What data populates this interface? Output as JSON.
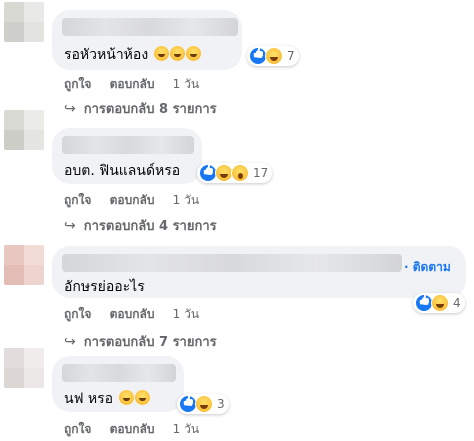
{
  "comments": [
    {
      "text": "รอหัวหน้าห้อง",
      "emojis": [
        "grinning-sweat-emoji",
        "grinning-sweat-emoji",
        "grinning-sweat-emoji"
      ],
      "reactions": [
        "like",
        "haha"
      ],
      "reaction_count": "7",
      "actions": {
        "like": "ถูกใจ",
        "reply": "ตอบกลับ",
        "time": "1 วัน"
      },
      "replies": "การตอบกลับ 8 รายการ"
    },
    {
      "text": "อบต. ฟินแลนด์หรอ",
      "emojis": [],
      "reactions": [
        "like",
        "haha",
        "wow"
      ],
      "reaction_count": "17",
      "actions": {
        "like": "ถูกใจ",
        "reply": "ตอบกลับ",
        "time": "1 วัน"
      },
      "replies": "การตอบกลับ 4 รายการ"
    },
    {
      "text": "อักษรย่ออะไร",
      "emojis": [],
      "follow": "· ติดตาม",
      "reactions": [
        "like",
        "haha"
      ],
      "reaction_count": "4",
      "actions": {
        "like": "ถูกใจ",
        "reply": "ตอบกลับ",
        "time": "1 วัน"
      },
      "replies": "การตอบกลับ 7 รายการ"
    },
    {
      "text": "นฟ หรอ",
      "emojis": [
        "rofl-emoji",
        "rofl-emoji"
      ],
      "reactions": [
        "like",
        "haha"
      ],
      "reaction_count": "3",
      "actions": {
        "like": "ถูกใจ",
        "reply": "ตอบกลับ",
        "time": "1 วัน"
      }
    }
  ]
}
